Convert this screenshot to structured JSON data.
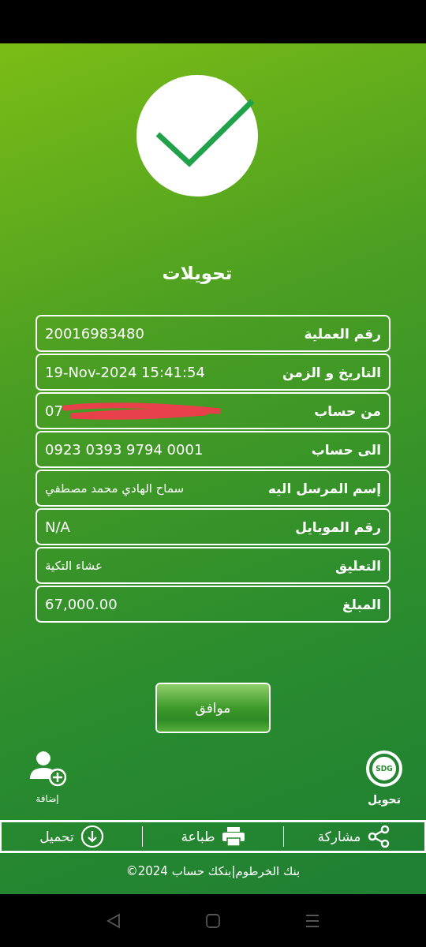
{
  "title": "تحويلات",
  "details": [
    {
      "label": "رقم العملية",
      "value": "20016983480"
    },
    {
      "label": "التاريخ و الزمن",
      "value": "19-Nov-2024 15:41:54"
    },
    {
      "label": "من حساب",
      "value": "07",
      "redacted": true
    },
    {
      "label": "الى حساب",
      "value": "0923 0393 9794 0001"
    },
    {
      "label": "إسم المرسل اليه",
      "value": "سماح الهادي محمد مصطفي",
      "kind": "arabic"
    },
    {
      "label": "رقم الموبايل",
      "value": "N/A"
    },
    {
      "label": "التعليق",
      "value": "عشاء التكية",
      "kind": "arabic"
    },
    {
      "label": "المبلغ",
      "value": "67,000.00"
    }
  ],
  "ok_button": "موافق",
  "transfer_shortcut": {
    "badge": "SDG",
    "label": "تحويل"
  },
  "add_shortcut": {
    "label": "إضافة"
  },
  "actions": [
    {
      "kind": "share",
      "label": "مشاركة"
    },
    {
      "kind": "print",
      "label": "طباعة"
    },
    {
      "kind": "download",
      "label": "تحميل"
    }
  ],
  "footer": "©2024 بنك الخرطوم|بنكك حساب"
}
